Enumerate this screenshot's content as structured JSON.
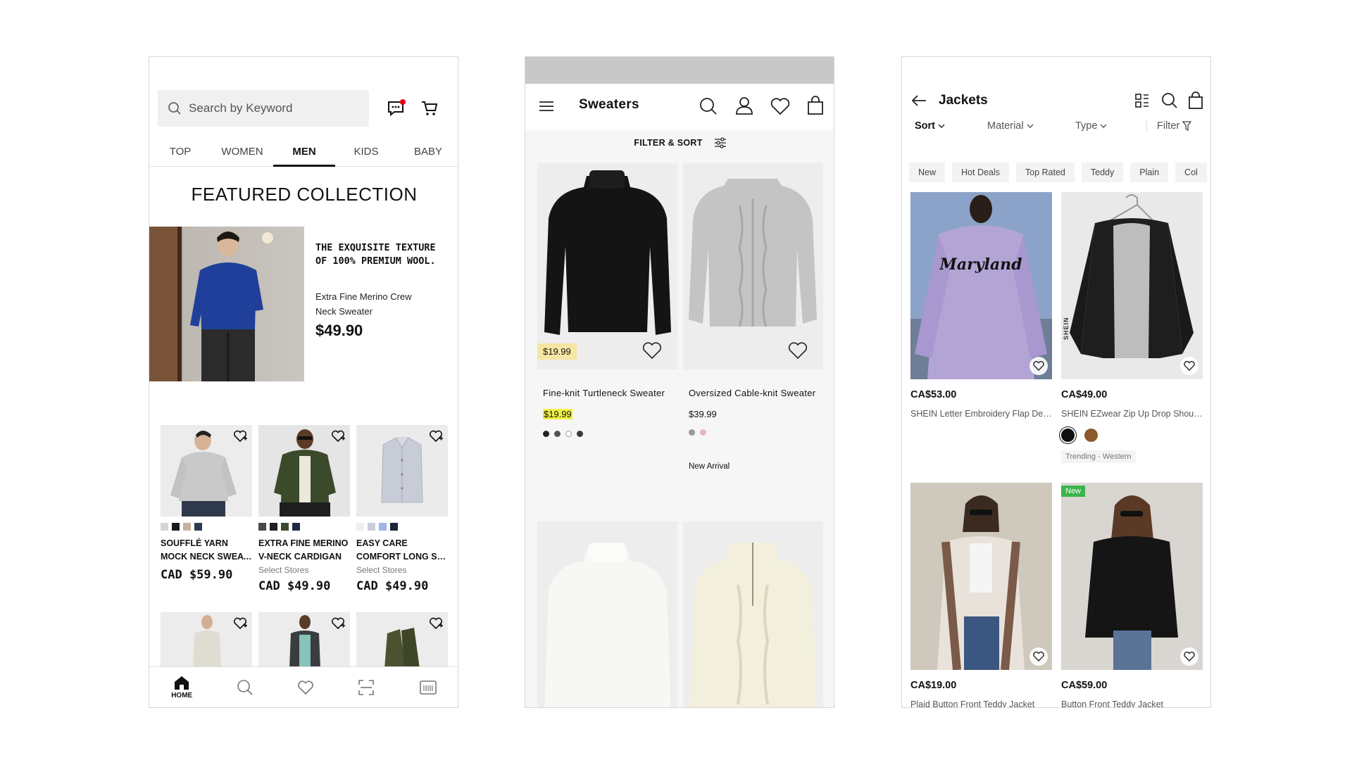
{
  "phone1": {
    "search_placeholder": "Search by Keyword",
    "tabs": [
      "TOP",
      "WOMEN",
      "MEN",
      "KIDS",
      "BABY"
    ],
    "active_tab": "MEN",
    "featured_title": "FEATURED COLLECTION",
    "hero": {
      "headline": "THE EXQUISITE TEXTURE OF 100% PREMIUM WOOL.",
      "product": "Extra Fine Merino Crew Neck Sweater",
      "price": "$49.90"
    },
    "products": [
      {
        "name1": "SOUFFLÉ YARN",
        "name2": "MOCK NECK SWEAT...",
        "sub": "",
        "price": "CAD $59.90",
        "swatches": [
          "#d4d4d4",
          "#1a1a1a",
          "#c6b39a",
          "#2d3a56"
        ]
      },
      {
        "name1": "EXTRA FINE MERINO",
        "name2": "V-NECK CARDIGAN",
        "sub": "Select Stores",
        "price": "CAD $49.90",
        "swatches": [
          "#4a4a4a",
          "#1f1f1f",
          "#3b4a2e",
          "#1e2a44"
        ]
      },
      {
        "name1": "EASY CARE",
        "name2": "COMFORT LONG SL...",
        "sub": "Select Stores",
        "price": "CAD $49.90",
        "swatches": [
          "#efefef",
          "#c9cdd8",
          "#9fb5e8",
          "#1d2338"
        ]
      }
    ],
    "bottom_nav_home": "HOME",
    "accent_red": "#e60012"
  },
  "phone2": {
    "title": "Sweaters",
    "filter_label": "FILTER & SORT",
    "products": [
      {
        "name": "Fine-knit Turtleneck Sweater",
        "price": "$19.99",
        "tag_price": "$19.99",
        "dots": [
          "#222222",
          "#555555",
          "#ffffff",
          "#3a3a3a"
        ]
      },
      {
        "name": "Oversized Cable-knit Sweater",
        "price": "$39.99",
        "dots": [
          "#9a9a9a",
          "#e2b7c2"
        ],
        "label": "New Arrival"
      }
    ]
  },
  "phone3": {
    "title": "Jackets",
    "filters": [
      "Sort",
      "Material",
      "Type",
      "Filter"
    ],
    "chips": [
      "New",
      "Hot Deals",
      "Top Rated",
      "Teddy",
      "Plain",
      "Col"
    ],
    "products": [
      {
        "price": "CA$53.00",
        "name": "SHEIN Letter Embroidery Flap Det...",
        "print": "Maryland"
      },
      {
        "price": "CA$49.00",
        "name": "SHEIN EZwear Zip Up Drop Shoul...",
        "swatches": [
          "#111111",
          "#8a5a2b"
        ],
        "trend": "Trending - Western",
        "brand": "SHEIN"
      },
      {
        "price": "CA$19.00",
        "name": "Plaid Button Front Teddy Jacket"
      },
      {
        "price": "CA$59.00",
        "name": "Button Front Teddy Jacket",
        "badge": "New"
      }
    ]
  }
}
